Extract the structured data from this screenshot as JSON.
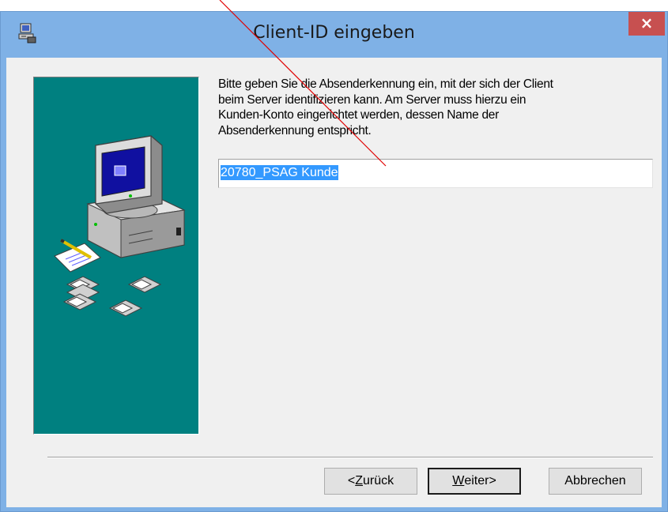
{
  "window": {
    "title": "Client-ID eingeben",
    "close_symbol": "×"
  },
  "content": {
    "description_lines": [
      "Bitte geben Sie die Absenderkennung  ein, mit der sich der Client",
      "beim Server identifizieren kann. Am Server muss hierzu ein",
      "Kunden-Konto eingerichtet werden, dessen Name der",
      "Absenderkennung entspricht."
    ],
    "client_id_value": "20780_PSAG Kunde"
  },
  "buttons": {
    "back": {
      "mnemonic": "Z",
      "rest": "urück",
      "prefix": "<"
    },
    "next": {
      "mnemonic": "W",
      "rest": "eiter>"
    },
    "cancel": {
      "label": "Abbrechen"
    }
  },
  "icons": {
    "app": "setup-computer-icon",
    "illustration": "computer-with-disks-illustration",
    "annotation": "red-arrow-line"
  },
  "colors": {
    "titlebar": "#7fb1e6",
    "close_button": "#c75050",
    "side_panel": "#008080",
    "selection": "#3399ff",
    "annotation": "#e00000"
  }
}
